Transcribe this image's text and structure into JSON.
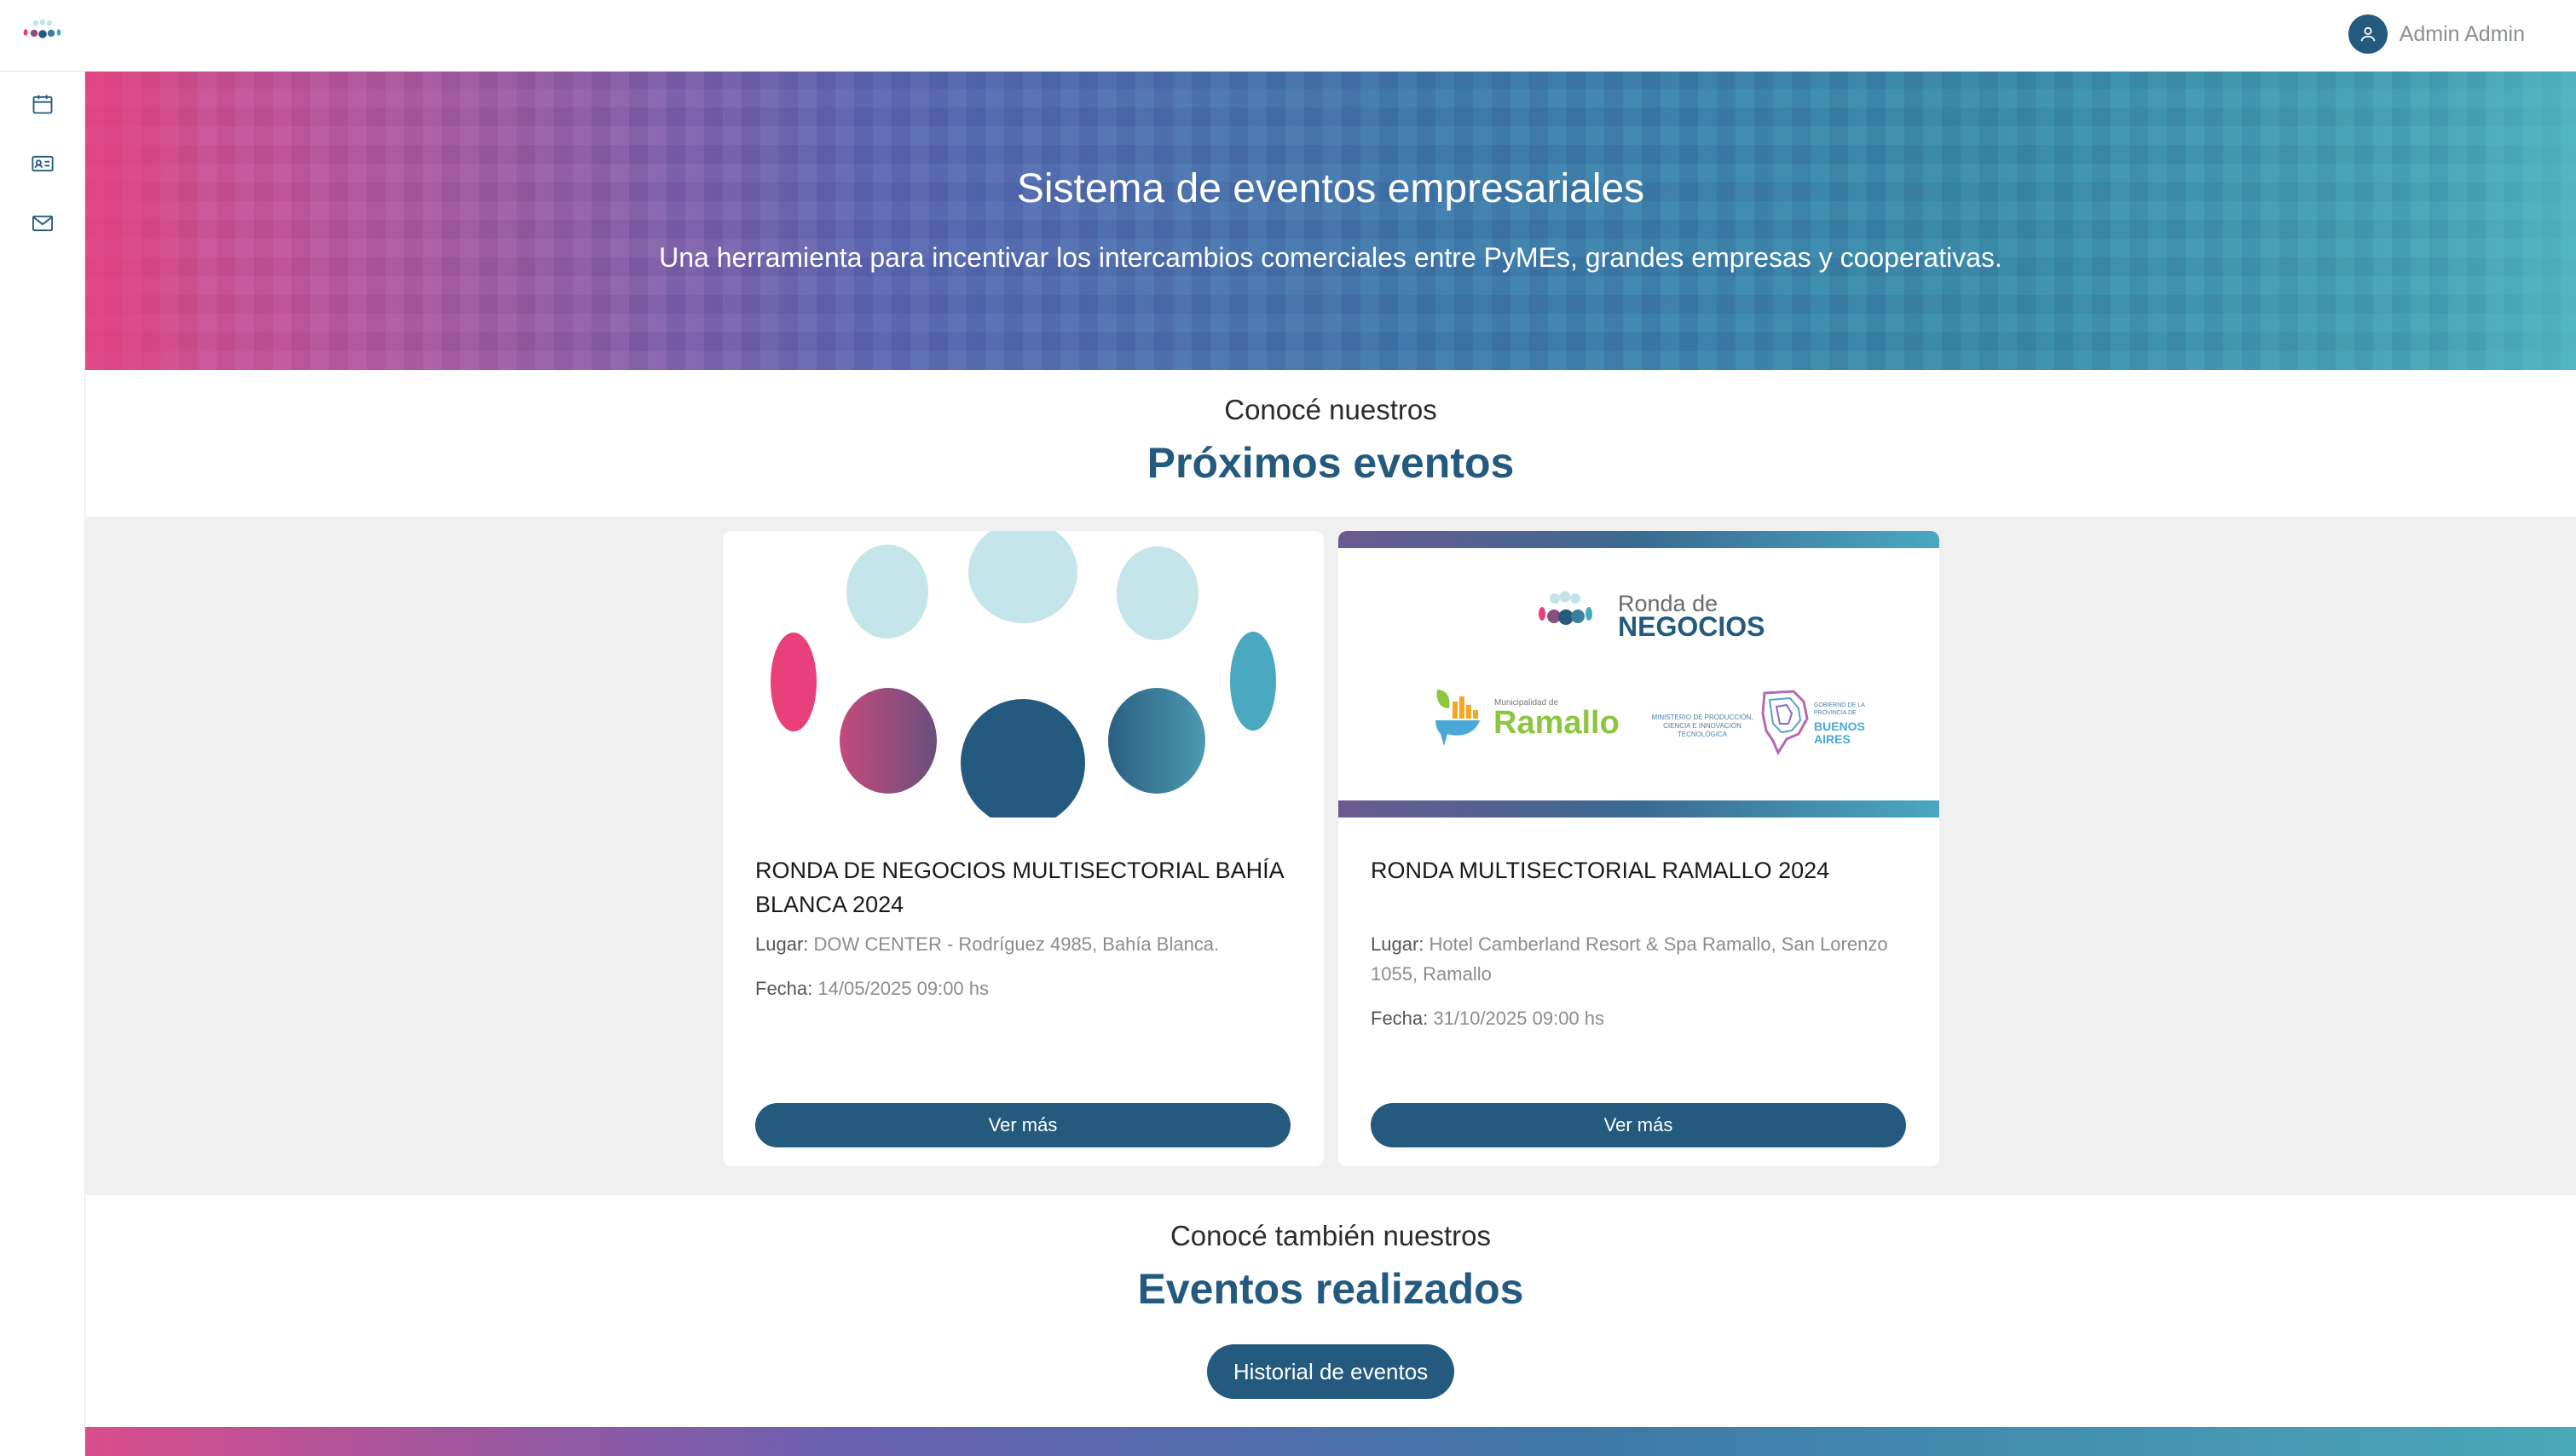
{
  "header": {
    "user_name": "Admin Admin"
  },
  "sidebar": {
    "items": [
      "calendar-icon",
      "id-card-icon",
      "mail-icon"
    ]
  },
  "hero": {
    "title": "Sistema de eventos empresariales",
    "subtitle": "Una herramienta para incentivar los intercambios comerciales entre PyMEs, grandes empresas y cooperativas."
  },
  "upcoming": {
    "pre": "Conocé nuestros",
    "title": "Próximos eventos"
  },
  "cards": [
    {
      "title": "RONDA DE NEGOCIOS MULTISECTORIAL BAHÍA BLANCA 2024",
      "place_label": "Lugar:",
      "place": "DOW CENTER - Rodríguez 4985, Bahía Blanca.",
      "date_label": "Fecha:",
      "date": "14/05/2025 09:00 hs",
      "button": "Ver más"
    },
    {
      "title": "RONDA MULTISECTORIAL RAMALLO 2024",
      "place_label": "Lugar:",
      "place": "Hotel Camberland Resort & Spa Ramallo, San Lorenzo 1055, Ramallo",
      "date_label": "Fecha:",
      "date": "31/10/2025 09:00 hs",
      "button": "Ver más",
      "logo": {
        "brand_top": "Ronda de",
        "brand_bottom": "NEGOCIOS",
        "muni_small": "Municipalidad de",
        "muni_name": "Ramallo",
        "ministry": "MINISTERIO DE PRODUCCIÓN, CIENCIA E INNOVACIÓN TECNOLÓGICA",
        "gov_small": "GOBIERNO DE LA PROVINCIA DE",
        "gov_name": "BUENOS AIRES"
      }
    }
  ],
  "past": {
    "pre": "Conocé también nuestros",
    "title": "Eventos realizados",
    "button": "Historial de eventos"
  },
  "colors": {
    "primary": "#245a7e",
    "accent_pink": "#e8407a",
    "accent_teal": "#4aa8c0"
  }
}
